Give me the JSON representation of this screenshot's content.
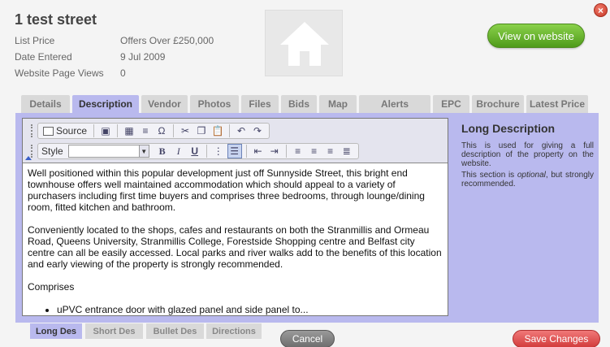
{
  "property": {
    "title": "1 test street",
    "info": [
      {
        "label": "List Price",
        "value": "Offers Over £250,000"
      },
      {
        "label": "Date Entered",
        "value": "9 Jul 2009"
      },
      {
        "label": "Website Page Views",
        "value": "0"
      }
    ],
    "view_button": "View on website",
    "close_icon": "close-icon"
  },
  "tabs": [
    {
      "label": "Details",
      "active": false
    },
    {
      "label": "Description",
      "active": true
    },
    {
      "label": "Vendor",
      "active": false
    },
    {
      "label": "Photos",
      "active": false
    },
    {
      "label": "Files",
      "active": false
    },
    {
      "label": "Bids",
      "active": false
    },
    {
      "label": "Map",
      "active": false
    },
    {
      "label": "Alerts",
      "active": false
    },
    {
      "label": "EPC",
      "active": false
    },
    {
      "label": "Brochure",
      "active": false
    },
    {
      "label": "Latest Price",
      "active": false
    }
  ],
  "toolbar": {
    "source_label": "Source",
    "style_label": "Style",
    "style_value": ""
  },
  "editor": {
    "paragraphs": [
      "Well positioned within this popular development just off Sunnyside Street, this bright end townhouse offers well maintained accommodation which should appeal to a variety of purchasers including first time buyers and comprises three bedrooms, through lounge/dining room, fitted kitchen and bathroom.",
      "Conveniently located to the shops, cafes and restaurants on both the Stranmillis and Ormeau Road, Queens University, Stranmillis College, Forestside Shopping centre and Belfast city centre can all be easily accessed. Local parks and river walks add to the benefits of this location and early viewing of the property is strongly recommended.",
      "Comprises"
    ],
    "bullets": [
      "uPVC entrance door with glazed panel and side panel to..."
    ]
  },
  "help": {
    "title": "Long Description",
    "text1": "This is used for giving a full description of the property on the website.",
    "text2_a": "This section is ",
    "text2_em": "optional",
    "text2_b": ", but strongly recommended."
  },
  "subtabs": [
    {
      "label": "Long Des",
      "active": true
    },
    {
      "label": "Short Des",
      "active": false
    },
    {
      "label": "Bullet Des",
      "active": false
    },
    {
      "label": "Directions",
      "active": false
    }
  ],
  "buttons": {
    "cancel": "Cancel",
    "save": "Save Changes"
  },
  "colors": {
    "accent_green": "#5fae22",
    "tab_active": "#b9b9ee",
    "save_red": "#e05050"
  }
}
